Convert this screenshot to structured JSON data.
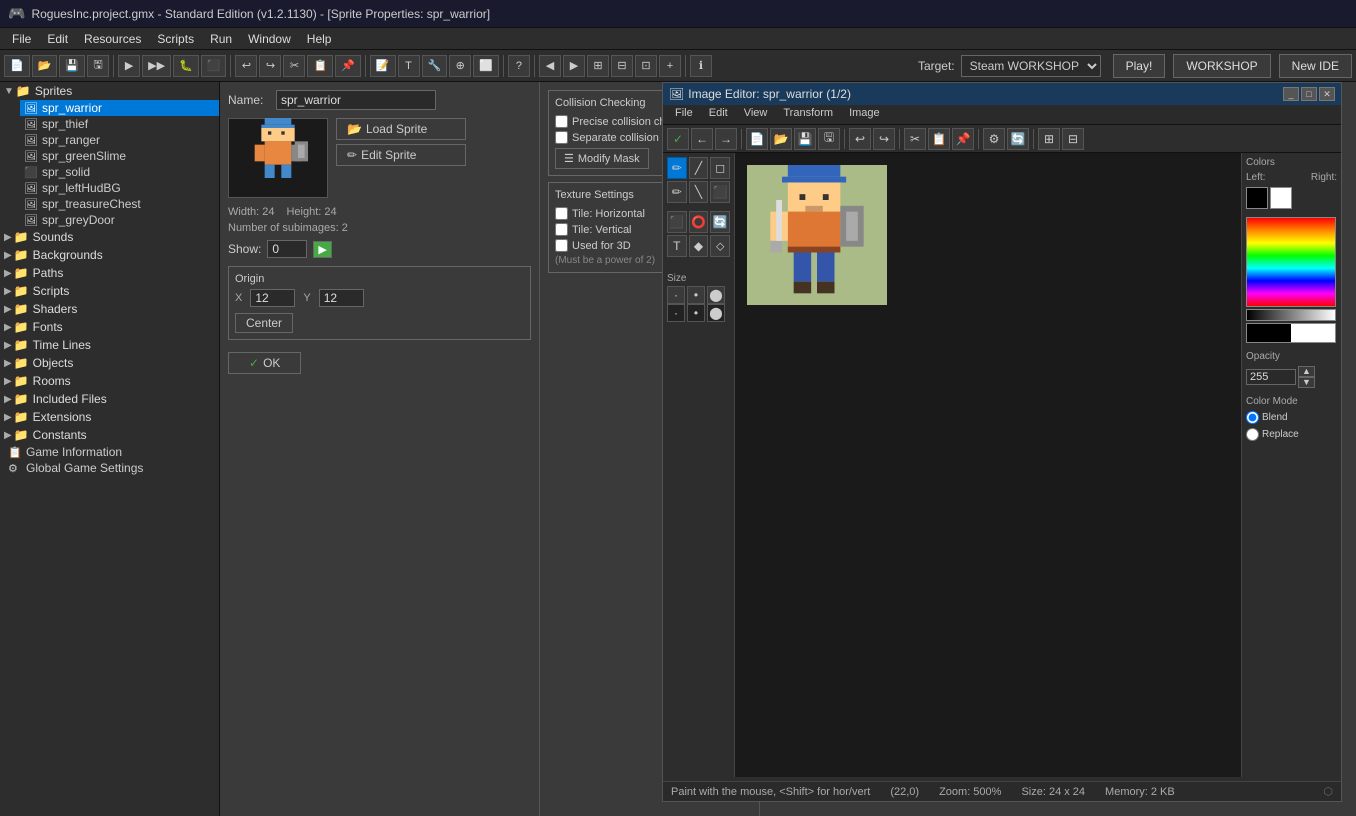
{
  "titlebar": {
    "icon": "🎮",
    "title": "RoguesInc.project.gmx  -  Standard Edition (v1.2.1130) - [Sprite Properties: spr_warrior]"
  },
  "menubar": {
    "items": [
      "File",
      "Edit",
      "Resources",
      "Scripts",
      "Run",
      "Window",
      "Help"
    ]
  },
  "toolbar": {
    "target_label": "Target:",
    "target_value": "Steam WORKSHOP",
    "play_btn": "Play!",
    "workshop_btn": "WORKSHOP",
    "new_ide_btn": "New IDE"
  },
  "sidebar": {
    "sprites_label": "Sprites",
    "sprites": [
      {
        "name": "spr_warrior",
        "selected": true
      },
      {
        "name": "spr_thief"
      },
      {
        "name": "spr_ranger"
      },
      {
        "name": "spr_greenSlime"
      },
      {
        "name": "spr_solid"
      },
      {
        "name": "spr_leftHudBG"
      },
      {
        "name": "spr_treasureChest"
      },
      {
        "name": "spr_greyDoor"
      }
    ],
    "sounds_label": "Sounds",
    "backgrounds_label": "Backgrounds",
    "paths_label": "Paths",
    "scripts_label": "Scripts",
    "shaders_label": "Shaders",
    "fonts_label": "Fonts",
    "time_lines_label": "Time Lines",
    "objects_label": "Objects",
    "rooms_label": "Rooms",
    "included_files_label": "Included Files",
    "extensions_label": "Extensions",
    "constants_label": "Constants",
    "game_information_label": "Game Information",
    "global_game_settings_label": "Global Game Settings"
  },
  "sprite_props": {
    "name_label": "Name:",
    "name_value": "spr_warrior",
    "load_sprite_btn": "Load Sprite",
    "edit_sprite_btn": "Edit Sprite",
    "width_label": "Width:",
    "width_value": "24",
    "height_label": "Height:",
    "height_value": "24",
    "subimages_label": "Number of subimages:",
    "subimages_value": "2",
    "show_label": "Show:",
    "show_value": "0",
    "origin_group": "Origin",
    "x_label": "X",
    "x_value": "12",
    "y_label": "Y",
    "y_value": "12",
    "center_btn": "Center",
    "ok_btn": "OK",
    "ok_checkmark": "✓"
  },
  "collision": {
    "title": "Collision Checking",
    "precise_label": "Precise collision checking",
    "separate_label": "Separate collision masks",
    "modify_mask_btn": "Modify Mask",
    "modify_icon": "☰"
  },
  "texture": {
    "title": "Texture Settings",
    "tile_h_label": "Tile: Horizontal",
    "tile_v_label": "Tile: Vertical",
    "used_3d_label": "Used for 3D",
    "power_label": "(Must be a power of 2)"
  },
  "image_editor": {
    "title": "Image Editor: spr_warrior (1/2)",
    "menubar": [
      "File",
      "Edit",
      "View",
      "Transform",
      "Image"
    ],
    "statusbar_text": "Paint with the mouse, <Shift> for hor/vert",
    "coords": "(22,0)",
    "zoom": "Zoom: 500%",
    "size": "Size: 24 x 24",
    "memory": "Memory: 2 KB",
    "colors_label": "Colors",
    "left_label": "Left:",
    "right_label": "Right:",
    "opacity_label": "Opacity",
    "opacity_value": "255",
    "color_mode_label": "Color Mode",
    "blend_label": "Blend",
    "replace_label": "Replace",
    "size_tools": [
      [
        1,
        1
      ],
      [
        2,
        2
      ],
      [
        4,
        4
      ],
      [
        1,
        1
      ],
      [
        2,
        2
      ],
      [
        4,
        4
      ]
    ]
  }
}
